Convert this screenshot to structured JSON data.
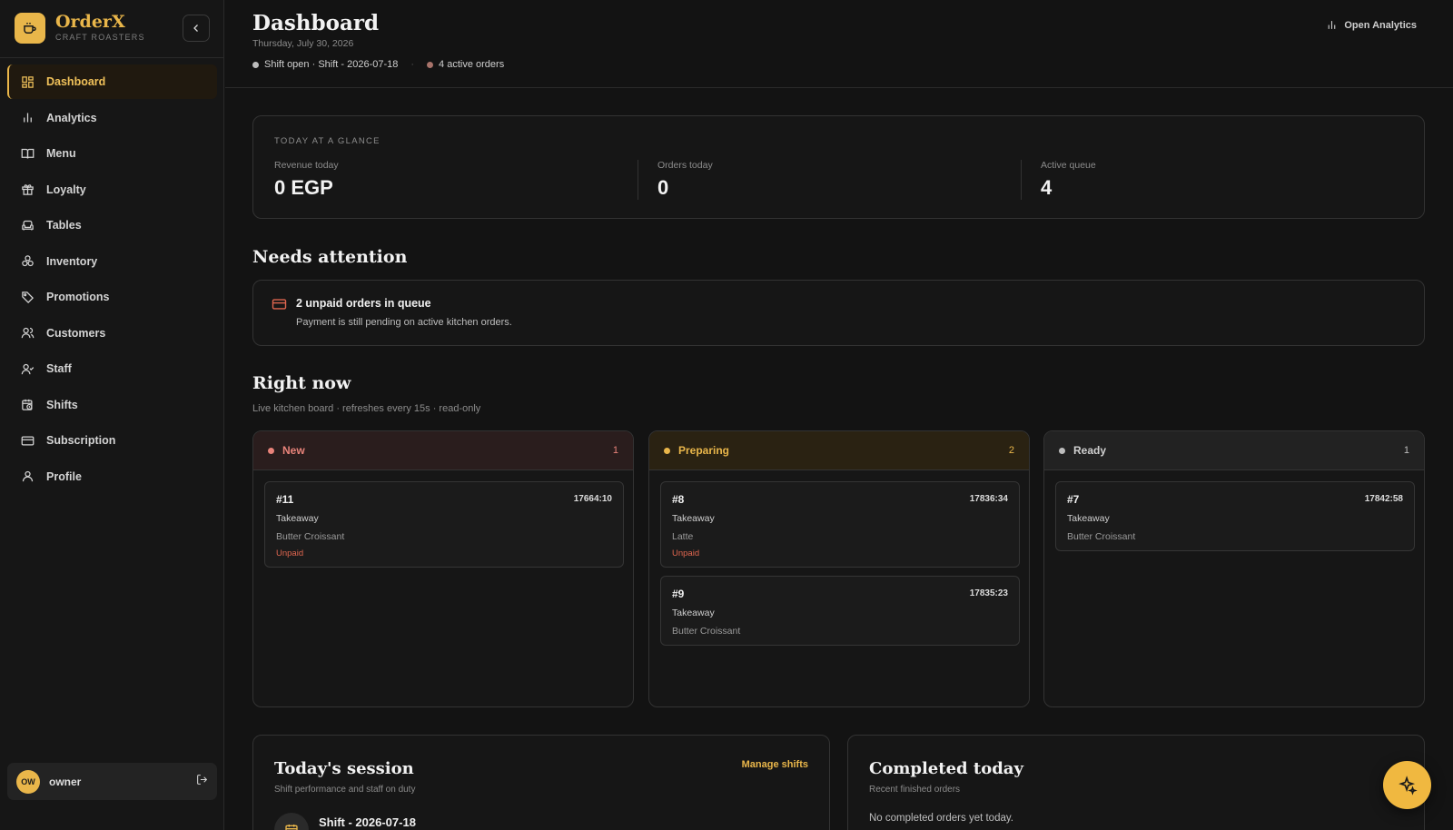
{
  "brand": {
    "name": "OrderX",
    "subtitle": "CRAFT ROASTERS"
  },
  "sidebar": {
    "items": [
      {
        "label": "Dashboard",
        "icon": "grid-icon",
        "active": true
      },
      {
        "label": "Analytics",
        "icon": "bar-chart-icon"
      },
      {
        "label": "Menu",
        "icon": "book-icon"
      },
      {
        "label": "Loyalty",
        "icon": "gift-icon"
      },
      {
        "label": "Tables",
        "icon": "sofa-icon"
      },
      {
        "label": "Inventory",
        "icon": "boxes-icon"
      },
      {
        "label": "Promotions",
        "icon": "tag-icon"
      },
      {
        "label": "Customers",
        "icon": "users-icon"
      },
      {
        "label": "Staff",
        "icon": "user-check-icon"
      },
      {
        "label": "Shifts",
        "icon": "calendar-clock-icon"
      },
      {
        "label": "Subscription",
        "icon": "credit-card-icon"
      },
      {
        "label": "Profile",
        "icon": "user-icon"
      }
    ],
    "user": {
      "initials": "OW",
      "name": "owner"
    }
  },
  "header": {
    "title": "Dashboard",
    "date": "Thursday, July 30, 2026",
    "shift_status": "Shift open · Shift - 2026-07-18",
    "separator": "·",
    "active_orders": "4 active orders",
    "open_analytics": "Open Analytics"
  },
  "glance": {
    "label": "TODAY AT A GLANCE",
    "metrics": [
      {
        "label": "Revenue today",
        "value": "0 EGP"
      },
      {
        "label": "Orders today",
        "value": "0"
      },
      {
        "label": "Active queue",
        "value": "4"
      }
    ]
  },
  "attention": {
    "title": "Needs attention",
    "alert_title": "2 unpaid orders in queue",
    "alert_desc": "Payment is still pending on active kitchen orders."
  },
  "right_now": {
    "title": "Right now",
    "subtitle": "Live kitchen board · refreshes every 15s · read-only",
    "columns": [
      {
        "name": "New",
        "count": "1",
        "color": "#e8837a",
        "head_bg": "#2a1d1d",
        "orders": [
          {
            "num": "#11",
            "time": "17664:10",
            "type": "Takeaway",
            "item": "Butter Croissant",
            "payment": "Unpaid"
          }
        ]
      },
      {
        "name": "Preparing",
        "count": "2",
        "color": "#e9b64a",
        "head_bg": "#2a2212",
        "orders": [
          {
            "num": "#8",
            "time": "17836:34",
            "type": "Takeaway",
            "item": "Latte",
            "payment": "Unpaid"
          },
          {
            "num": "#9",
            "time": "17835:23",
            "type": "Takeaway",
            "item": "Butter Croissant",
            "payment": ""
          }
        ]
      },
      {
        "name": "Ready",
        "count": "1",
        "color": "#bdbdbd",
        "head_bg": "#222222",
        "orders": [
          {
            "num": "#7",
            "time": "17842:58",
            "type": "Takeaway",
            "item": "Butter Croissant",
            "payment": ""
          }
        ]
      }
    ]
  },
  "session": {
    "title": "Today's session",
    "subtitle": "Shift performance and staff on duty",
    "manage": "Manage shifts",
    "shift_name": "Shift - 2026-07-18"
  },
  "completed": {
    "title": "Completed today",
    "subtitle": "Recent finished orders",
    "empty": "No completed orders yet today."
  },
  "colors": {
    "accent": "#e9b64a",
    "danger": "#e0664f",
    "background": "#131313"
  }
}
